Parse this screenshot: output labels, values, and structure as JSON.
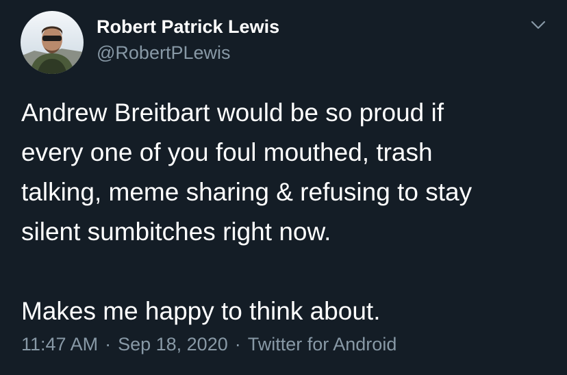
{
  "author": {
    "display_name": "Robert Patrick Lewis",
    "handle": "@RobertPLewis",
    "avatar_icon": "profile-photo"
  },
  "tweet": {
    "lines": [
      "Andrew Breitbart would be so proud if",
      "every one of you foul mouthed, trash",
      "talking, meme sharing & refusing to stay",
      "silent sumbitches right now."
    ],
    "closing": "Makes me happy to think about."
  },
  "meta": {
    "time": "11:47 AM",
    "separator": "·",
    "date": "Sep 18, 2020",
    "source": "Twitter for Android"
  },
  "menu_icon": "chevron-down-icon",
  "colors": {
    "background": "#141d26",
    "primary_text": "#ffffff",
    "secondary_text": "#8899a6"
  }
}
